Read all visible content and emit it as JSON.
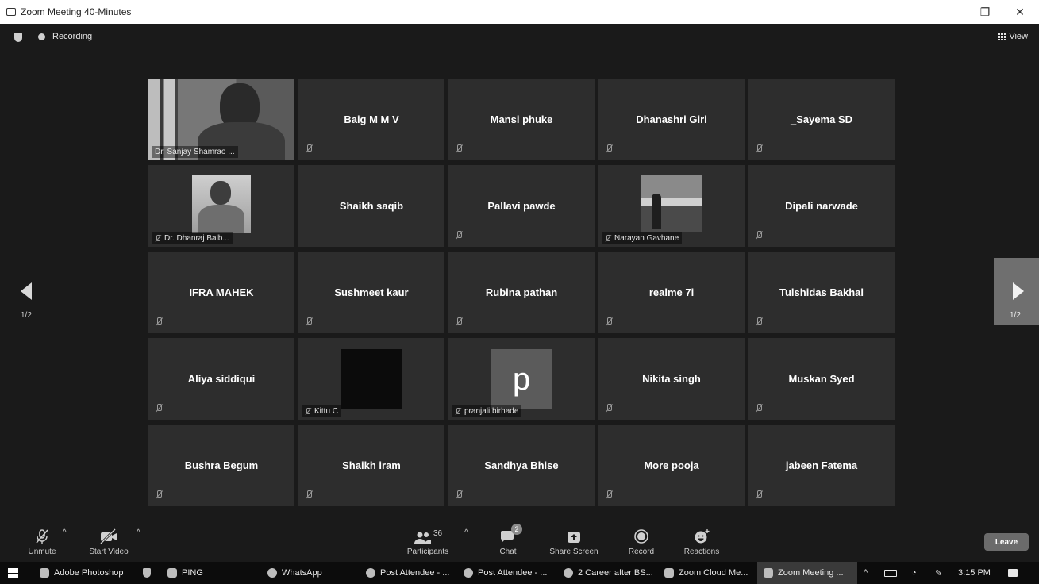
{
  "window": {
    "title": "Zoom Meeting 40-Minutes",
    "minimize": "–",
    "restore": "❐",
    "close": "✕"
  },
  "topbar": {
    "recording": "Recording",
    "view": "View"
  },
  "tiles": [
    {
      "name": "Dr. Sanjay Shamrao ...",
      "type": "video"
    },
    {
      "name": "Baig M M V"
    },
    {
      "name": "Mansi phuke"
    },
    {
      "name": "Dhanashri Giri"
    },
    {
      "name": "_Sayema SD"
    },
    {
      "name": "Dr. Dhanraj Balb...",
      "type": "photo"
    },
    {
      "name": "Shaikh saqib"
    },
    {
      "name": "Pallavi pawde"
    },
    {
      "name": "Narayan Gavhane",
      "type": "photo"
    },
    {
      "name": "Dipali narwade"
    },
    {
      "name": "IFRA MAHEK"
    },
    {
      "name": "Sushmeet kaur"
    },
    {
      "name": "Rubina pathan"
    },
    {
      "name": "realme 7i"
    },
    {
      "name": "Tulshidas Bakhal"
    },
    {
      "name": "Aliya siddiqui"
    },
    {
      "name": "Kittu C",
      "type": "photo"
    },
    {
      "name": "pranjali birhade",
      "type": "initial",
      "initial": "p"
    },
    {
      "name": "Nikita singh"
    },
    {
      "name": "Muskan Syed"
    },
    {
      "name": "Bushra Begum"
    },
    {
      "name": "Shaikh iram"
    },
    {
      "name": "Sandhya Bhise"
    },
    {
      "name": "More pooja"
    },
    {
      "name": "jabeen Fatema"
    }
  ],
  "pagination": {
    "left": "1/2",
    "right": "1/2"
  },
  "toolbar": {
    "unmute": "Unmute",
    "start_video": "Start Video",
    "participants": "Participants",
    "participant_count": "36",
    "chat": "Chat",
    "chat_badge": "2",
    "share_screen": "Share Screen",
    "record": "Record",
    "reactions": "Reactions",
    "leave": "Leave"
  },
  "taskbar": {
    "items": [
      "Adobe Photoshop",
      "PING",
      "WhatsApp",
      "Post Attendee - ...",
      "Post Attendee - ...",
      "2 Career after BS...",
      "Zoom Cloud Me...",
      "Zoom Meeting ..."
    ],
    "time": "3:15 PM"
  }
}
